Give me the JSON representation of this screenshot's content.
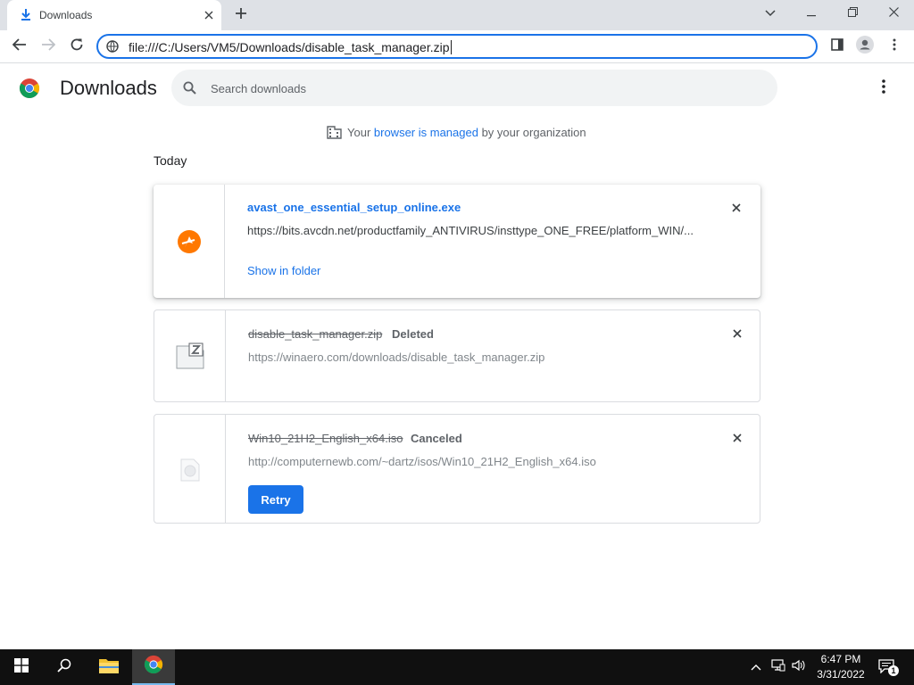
{
  "browser": {
    "tab": {
      "title": "Downloads",
      "icon": "download-icon"
    },
    "new_tab_icon": "plus-icon",
    "window_controls": [
      "chevron-down-icon",
      "minimize-icon",
      "restore-icon",
      "close-icon"
    ],
    "address": "file:///C:/Users/VM5/Downloads/disable_task_manager.zip"
  },
  "page": {
    "title": "Downloads",
    "search_placeholder": "Search downloads",
    "managed_notice": {
      "prefix": "Your ",
      "link": "browser is managed",
      "suffix": " by your organization"
    },
    "section_label": "Today"
  },
  "downloads": [
    {
      "name": "avast_one_essential_setup_online.exe",
      "url": "https://bits.avcdn.net/productfamily_ANTIVIRUS/insttype_ONE_FREE/platform_WIN/...",
      "action": "Show in folder",
      "icon": "avast-icon"
    },
    {
      "name": "disable_task_manager.zip",
      "status": "Deleted",
      "url": "https://winaero.com/downloads/disable_task_manager.zip",
      "icon": "zip-file-icon"
    },
    {
      "name": "Win10_21H2_English_x64.iso",
      "status": "Canceled",
      "url": "http://computernewb.com/~dartz/isos/Win10_21H2_English_x64.iso",
      "action": "Retry",
      "icon": "generic-file-icon"
    }
  ],
  "taskbar": {
    "time": "6:47 PM",
    "date": "3/31/2022",
    "notification_count": "1",
    "colors": {
      "accent": "#1a73e8",
      "taskbar": "#101010"
    }
  }
}
